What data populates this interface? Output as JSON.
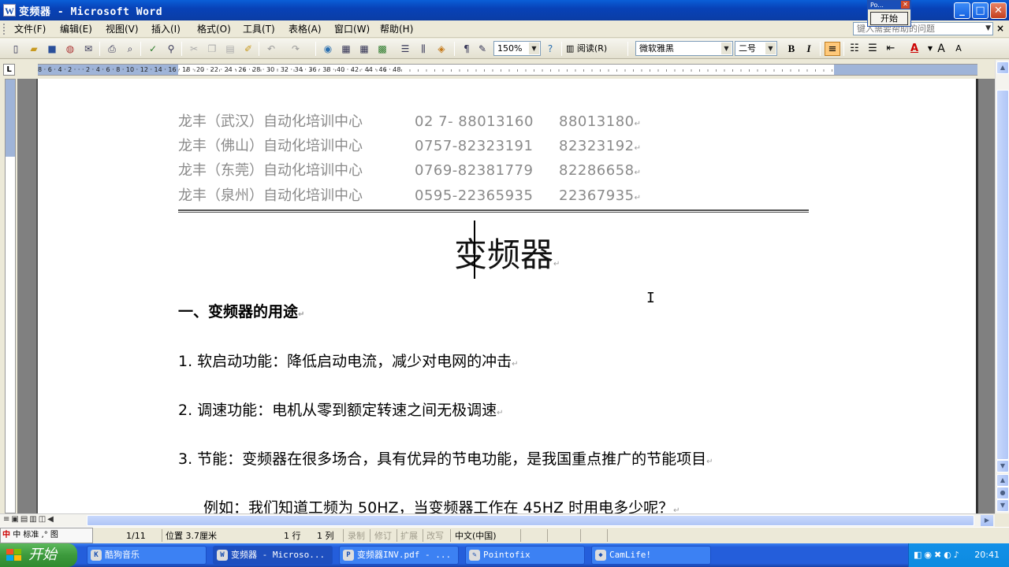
{
  "window": {
    "title": "变频器 - Microsoft Word",
    "app_icon": "W",
    "buttons": {
      "minimize": "_",
      "maximize": "□",
      "close": "✕"
    }
  },
  "popup": {
    "title": "Po...",
    "close": "✕",
    "button": "开始"
  },
  "menubar": {
    "items": [
      "文件(F)",
      "编辑(E)",
      "视图(V)",
      "插入(I)",
      "格式(O)",
      "工具(T)",
      "表格(A)",
      "窗口(W)",
      "帮助(H)"
    ],
    "help_placeholder": "键入需要帮助的问题",
    "close": "×"
  },
  "toolbar": {
    "zoom": "150%",
    "read_label": "阅读(R)",
    "font": "微软雅黑",
    "size": "二号",
    "bold": "B",
    "italic": "I",
    "font_color_icon": "A",
    "grow": "A",
    "shrink": "A"
  },
  "ruler": {
    "corner": "L",
    "numbers": "8 · 6 · 4 · 2 · · · 2 · 4 · 6 · 8 · 10 · 12 · 14 · 16 · 18 · 20 · 22 · 24 · 26 · 28 · 30 · 32 · 34 · 36 · 38 · 40 · 42 · 44 · 46 · 48"
  },
  "document": {
    "header_lines": [
      {
        "org": "龙丰（武汉）自动化培训中心",
        "phone1": "02 7- 88013160",
        "phone2": "88013180"
      },
      {
        "org": "龙丰（佛山）自动化培训中心",
        "phone1": "0757-82323191",
        "phone2": "82323192"
      },
      {
        "org": "龙丰（东莞）自动化培训中心",
        "phone1": "0769-82381779",
        "phone2": "82286658"
      },
      {
        "org": "龙丰（泉州）自动化培训中心",
        "phone1": "0595-22365935",
        "phone2": "22367935"
      }
    ],
    "paragraph_mark": "↵",
    "title": "变频器",
    "heading1": "一、变频器的用途",
    "items": [
      "1. 软启动功能：降低启动电流，减少对电网的冲击",
      "2. 调速功能：电机从零到额定转速之间无极调速",
      "3. 节能：变频器在很多场合，具有优异的节电功能，是我国重点推广的节能项目"
    ],
    "example": "例如：我们知道工频为 50HZ，当变频器工作在 45HZ 时用电多少呢？"
  },
  "statusbar": {
    "ime": "中 标准 ,° 图",
    "page_label": "1/11",
    "position": "位置 3.7厘米",
    "line": "1 行",
    "column": "1 列",
    "rec": "录制",
    "trk": "修订",
    "ext": "扩展",
    "ovr": "改写",
    "language": "中文(中国)"
  },
  "taskbar": {
    "start": "开始",
    "tasks": [
      {
        "label": "酷狗音乐",
        "icon": "K"
      },
      {
        "label": "变频器 - Microso...",
        "icon": "W"
      },
      {
        "label": "变频器INV.pdf - ...",
        "icon": "P"
      },
      {
        "label": "Pointofix",
        "icon": "✎"
      },
      {
        "label": "CamLife!",
        "icon": "◆"
      }
    ],
    "clock": "20:41"
  }
}
